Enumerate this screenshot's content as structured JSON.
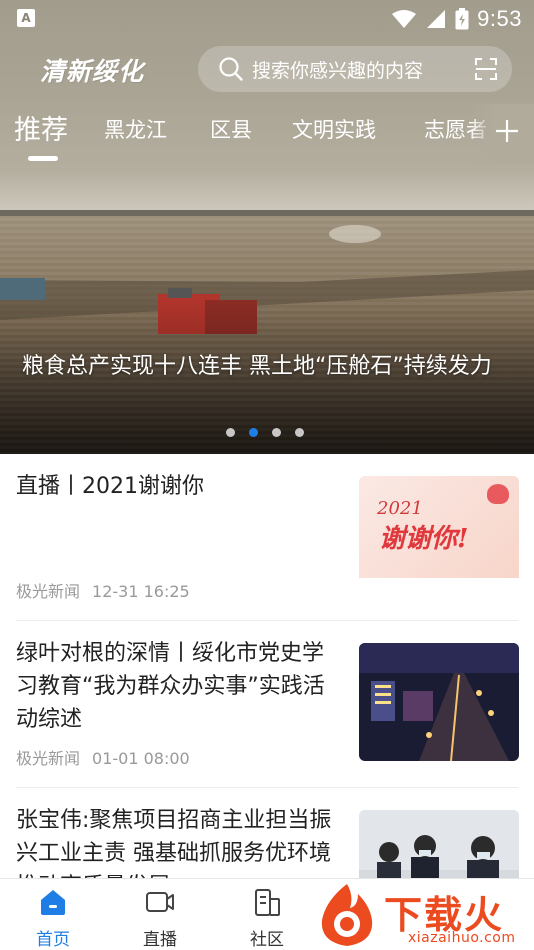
{
  "status_bar": {
    "left_icon": "A",
    "time": "9:53",
    "icons": [
      "wifi-icon",
      "signal-icon",
      "battery-charging-icon"
    ]
  },
  "app": {
    "logo_text": "清新绥化"
  },
  "search": {
    "placeholder": "搜索你感兴趣的内容",
    "icons": [
      "search-icon",
      "scan-icon"
    ]
  },
  "tabs": [
    {
      "label": "推荐",
      "active": true
    },
    {
      "label": "黑龙江"
    },
    {
      "label": "区县"
    },
    {
      "label": "文明实践"
    },
    {
      "label": "志愿者"
    }
  ],
  "banner": {
    "caption": "粮食总产实现十八连丰 黑土地“压舱石”持续发力",
    "slide_count": 4,
    "active_slide": 2
  },
  "news": [
    {
      "title": "直播丨2021谢谢你",
      "source": "极光新闻",
      "time": "12-31 16:25",
      "thumb": {
        "script": "2021",
        "big": "谢谢你!"
      }
    },
    {
      "title": "绿叶对根的深情丨绥化市党史学习教育“我为群众办实事”实践活动综述",
      "source": "极光新闻",
      "time": "01-01 08:00"
    },
    {
      "title": "张宝伟:聚焦项目招商主业担当振兴工业主责 强基础抓服务优环境推动高质量发展",
      "source": "",
      "time": ""
    }
  ],
  "bottom_nav": [
    {
      "label": "首页",
      "icon": "home-icon",
      "active": true
    },
    {
      "label": "直播",
      "icon": "video-icon"
    },
    {
      "label": "社区",
      "icon": "community-icon"
    }
  ],
  "watermark": {
    "text": "下载火",
    "domain": "xiazaihuo.com"
  },
  "colors": {
    "accent": "#1f7de6",
    "header_bg": "#aaa495",
    "meta_text": "#999999",
    "watermark": "#ec4a1f"
  }
}
